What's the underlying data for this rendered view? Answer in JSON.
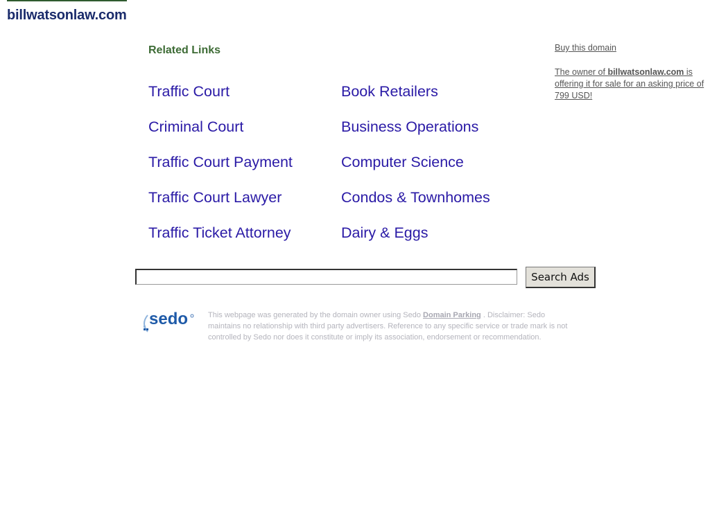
{
  "site": {
    "domain_title": "billwatsonlaw.com"
  },
  "related": {
    "heading": "Related Links",
    "left_links": [
      "Traffic Court",
      "Criminal Court",
      "Traffic Court Payment",
      "Traffic Court Lawyer",
      "Traffic Ticket Attorney"
    ],
    "right_links": [
      "Book Retailers",
      "Business Operations",
      "Computer Science",
      "Condos & Townhomes",
      "Dairy & Eggs"
    ]
  },
  "sidebar": {
    "buy_link": "Buy this domain",
    "owner_prefix": "The owner of ",
    "owner_domain": "billwatsonlaw.com",
    "owner_suffix": " is offering it for sale for an asking price of 799 USD!"
  },
  "search": {
    "input_value": "",
    "button_label": "Search Ads"
  },
  "footer": {
    "logo_text": "sedo",
    "text_before": "This webpage was generated by the domain owner using Sedo ",
    "domain_parking_link": "Domain Parking",
    "text_after": " . Disclaimer: Sedo maintains no relationship with third party advertisers. Reference to any specific service or trade mark is not controlled by Sedo nor does it constitute or imply its association, endorsement or recommendation."
  },
  "colors": {
    "title": "#1a2b6b",
    "heading": "#3d6b35",
    "link": "#2a1aa6",
    "sedo_blue": "#1e5aa8"
  }
}
